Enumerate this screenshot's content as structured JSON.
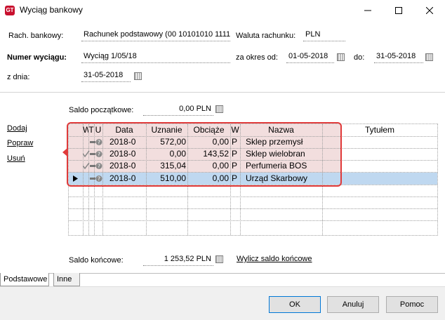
{
  "window": {
    "title": "Wyciąg bankowy",
    "app_icon_text": "GT"
  },
  "form": {
    "account_label": "Rach. bankowy:",
    "account_value": "Rachunek podstawowy (00 10101010 1111",
    "currency_label": "Waluta rachunku:",
    "currency_value": "PLN",
    "number_label": "Numer wyciągu:",
    "number_value": "Wyciąg 1/05/18",
    "period_from_label": "za okres od:",
    "period_from_value": "01-05-2018",
    "period_to_label": "do:",
    "period_to_value": "31-05-2018",
    "date_label": "z dnia:",
    "date_value": "31-05-2018"
  },
  "balance": {
    "opening_label": "Saldo początkowe:",
    "opening_value": "0,00 PLN",
    "closing_label": "Saldo końcowe:",
    "closing_value": "1 253,52 PLN",
    "compute_link": "Wylicz saldo końcowe"
  },
  "actions": {
    "add": "Dodaj",
    "edit": "Popraw",
    "delete": "Usuń"
  },
  "grid": {
    "headers": {
      "w1": "W",
      "t": "T",
      "u": "U",
      "date": "Data",
      "credit": "Uznanie",
      "debit": "Obciąże",
      "w2": "W",
      "name": "Nazwa",
      "title": "Tytułem"
    },
    "rows": [
      {
        "date": "2018-0",
        "credit": "572,00",
        "debit": "0,00",
        "w": "P",
        "name": "Sklep przemysł",
        "title": ""
      },
      {
        "date": "2018-0",
        "credit": "0,00",
        "debit": "143,52",
        "w": "P",
        "name": "Sklep wielobran",
        "title": ""
      },
      {
        "date": "2018-0",
        "credit": "315,04",
        "debit": "0,00",
        "w": "P",
        "name": "Perfumeria BOS",
        "title": ""
      },
      {
        "date": "2018-0",
        "credit": "510,00",
        "debit": "0,00",
        "w": "P",
        "name": "Urząd Skarbowy",
        "title": ""
      }
    ]
  },
  "tabs": [
    {
      "label": "Podstawowe"
    },
    {
      "label": "Inne"
    }
  ],
  "buttons": {
    "ok": "OK",
    "cancel": "Anuluj",
    "help": "Pomoc"
  },
  "colors": {
    "highlight": "#e03a3a",
    "selected_row": "#bfd8f0",
    "red_rows": "#e6bebe"
  }
}
